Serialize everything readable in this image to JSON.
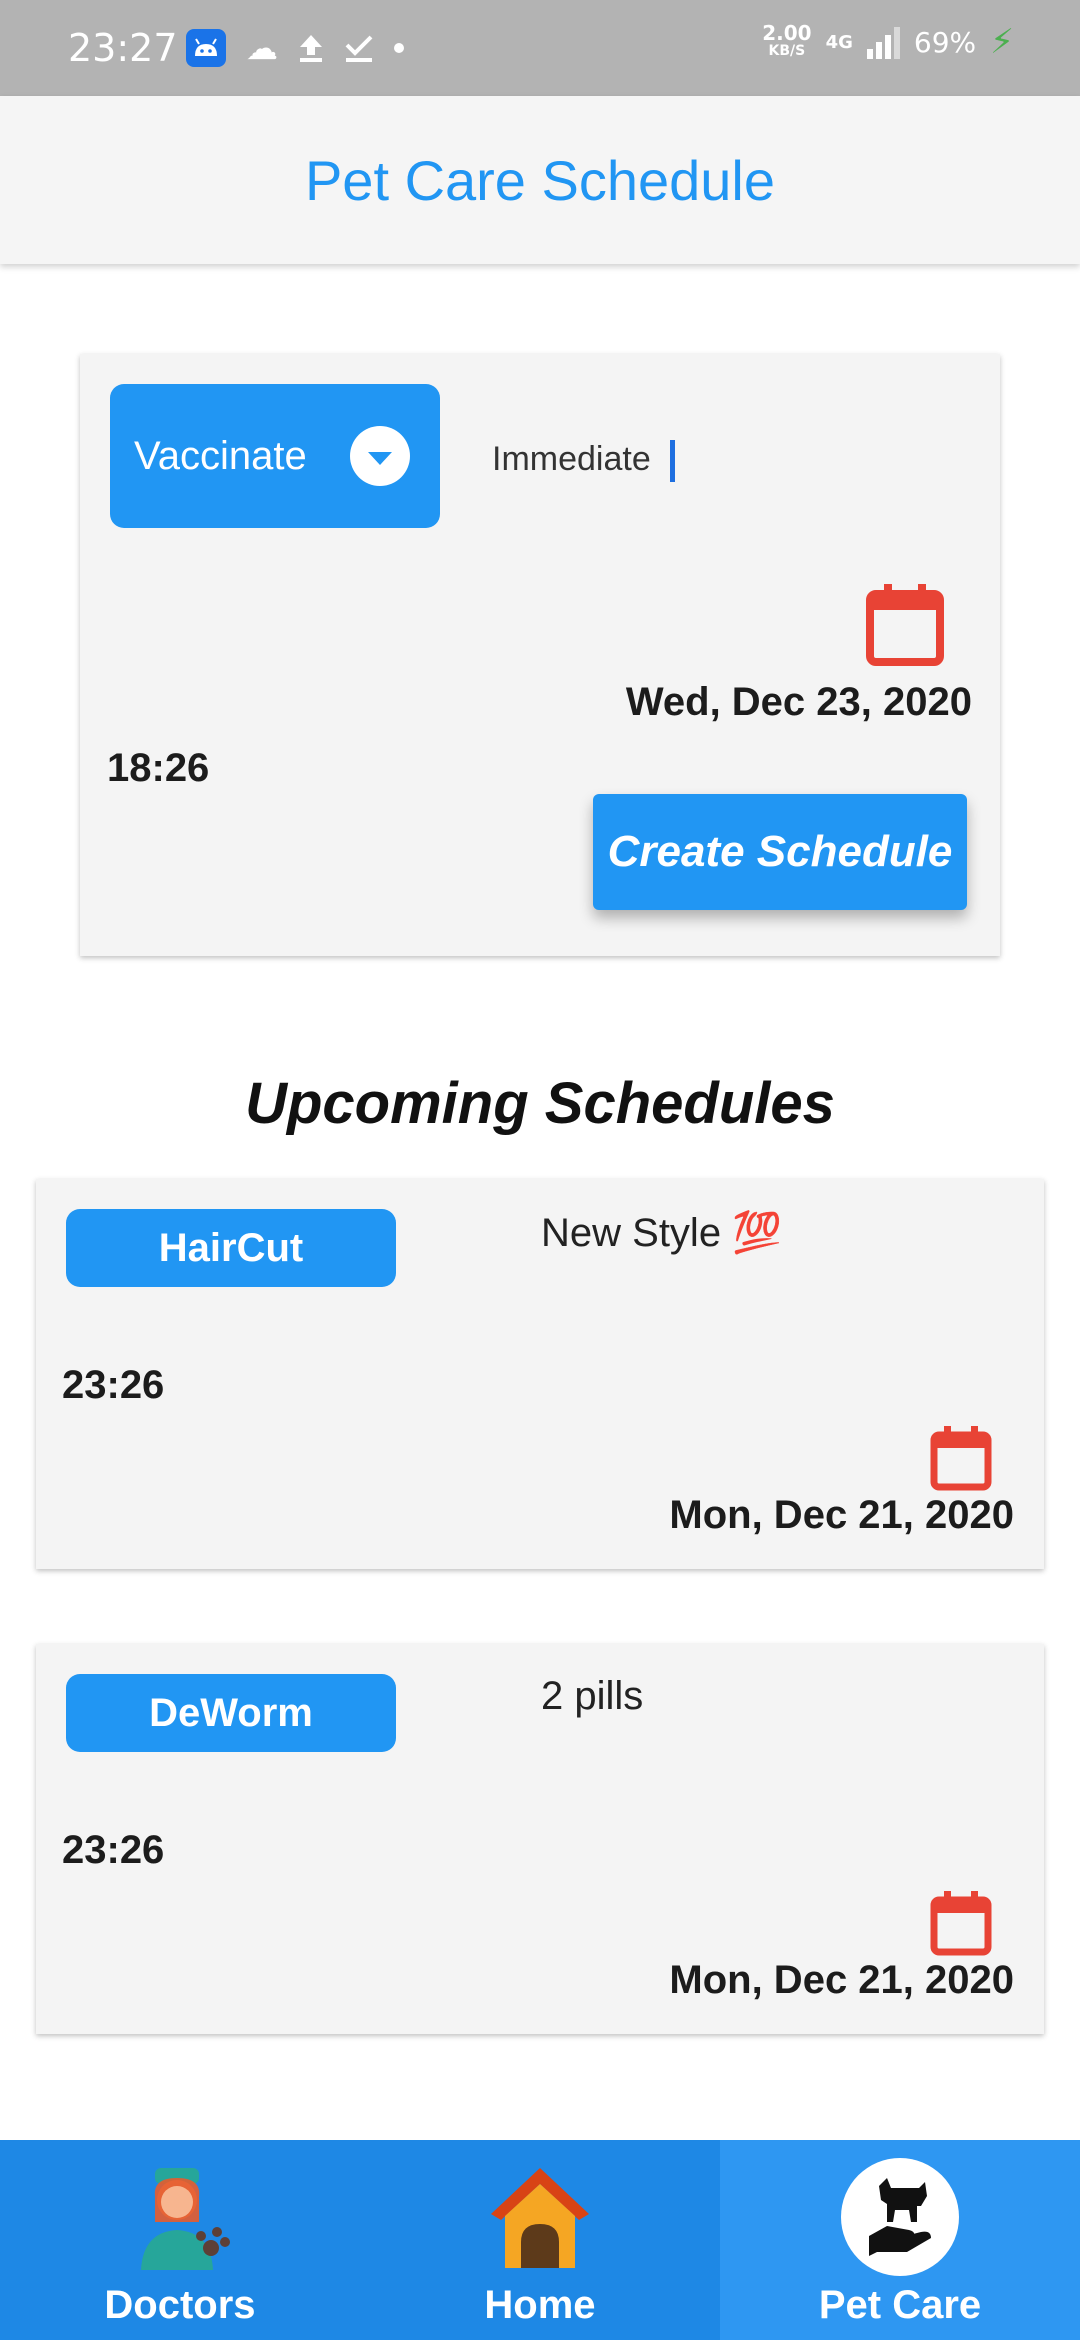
{
  "status_bar": {
    "time": "23:27",
    "net_speed_value": "2.00",
    "net_speed_unit": "KB/S",
    "network_type": "4G",
    "battery": "69%"
  },
  "app_bar": {
    "title": "Pet Care Schedule"
  },
  "form": {
    "type_selected": "Vaccinate",
    "note_value": "Immediate",
    "date": "Wed, Dec 23, 2020",
    "time": "18:26",
    "create_button": "Create Schedule"
  },
  "upcoming": {
    "title": "Upcoming Schedules",
    "items": [
      {
        "type": "HairCut",
        "note": "New Style 💯",
        "time": "23:26",
        "date": "Mon, Dec 21, 2020"
      },
      {
        "type": "DeWorm",
        "note": "2 pills",
        "time": "23:26",
        "date": "Mon, Dec 21, 2020"
      }
    ]
  },
  "bottom_nav": {
    "items": [
      {
        "label": "Doctors",
        "icon": "doctor-icon"
      },
      {
        "label": "Home",
        "icon": "dog-house-icon"
      },
      {
        "label": "Pet Care",
        "icon": "pet-care-icon"
      }
    ],
    "active": "Pet Care"
  },
  "colors": {
    "primary": "#2196f3",
    "calendar": "#e84335",
    "status_bar": "#b3b3b3"
  }
}
